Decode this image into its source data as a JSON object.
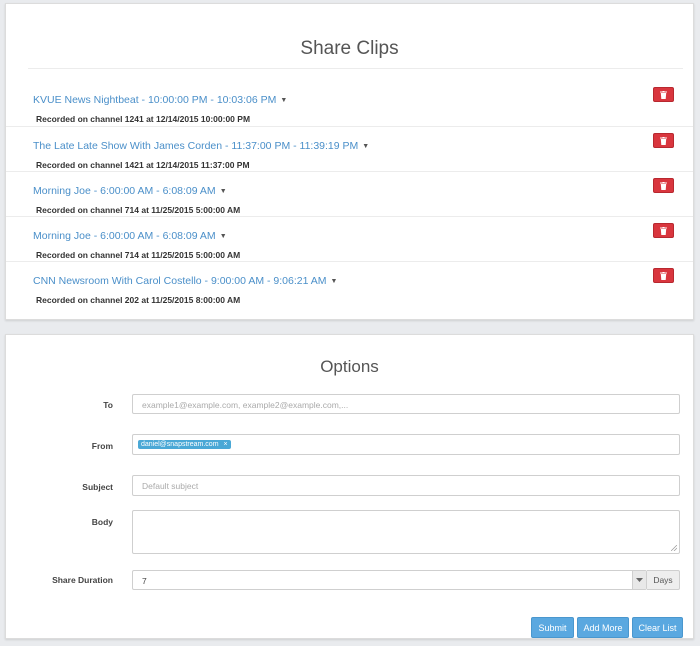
{
  "clips_panel": {
    "title": "Share Clips",
    "clips": [
      {
        "title": "KVUE News Nightbeat - 10:00:00 PM - 10:03:06 PM",
        "meta": "Recorded on channel 1241 at 12/14/2015 10:00:00 PM"
      },
      {
        "title": "The Late Late Show With James Corden - 11:37:00 PM - 11:39:19 PM",
        "meta": "Recorded on channel 1421 at 12/14/2015 11:37:00 PM"
      },
      {
        "title": "Morning Joe - 6:00:00 AM - 6:08:09 AM",
        "meta": "Recorded on channel 714 at 11/25/2015 5:00:00 AM"
      },
      {
        "title": "Morning Joe - 6:00:00 AM - 6:08:09 AM",
        "meta": "Recorded on channel 714 at 11/25/2015 5:00:00 AM"
      },
      {
        "title": "CNN Newsroom With Carol Costello - 9:00:00 AM - 9:06:21 AM",
        "meta": "Recorded on channel 202 at 11/25/2015 8:00:00 AM"
      }
    ],
    "caret_glyph": "▼",
    "delete_icon": "trash-icon"
  },
  "options_panel": {
    "title": "Options",
    "to": {
      "label": "To",
      "placeholder": "example1@example.com, example2@example.com,..."
    },
    "from": {
      "label": "From",
      "tag": "daniel@snapstream.com",
      "tag_remove": "×"
    },
    "subject": {
      "label": "Subject",
      "placeholder": "Default subject"
    },
    "body": {
      "label": "Body",
      "value": ""
    },
    "share_duration": {
      "label": "Share Duration",
      "value": "7",
      "unit": "Days"
    },
    "buttons": {
      "submit": "Submit",
      "add_more": "Add More",
      "clear_list": "Clear List"
    }
  },
  "colors": {
    "link": "#4a8fc9",
    "danger": "#d9363e",
    "primary": "#5aa8e0",
    "tag": "#4aa8d6",
    "background": "#e9ebee"
  }
}
